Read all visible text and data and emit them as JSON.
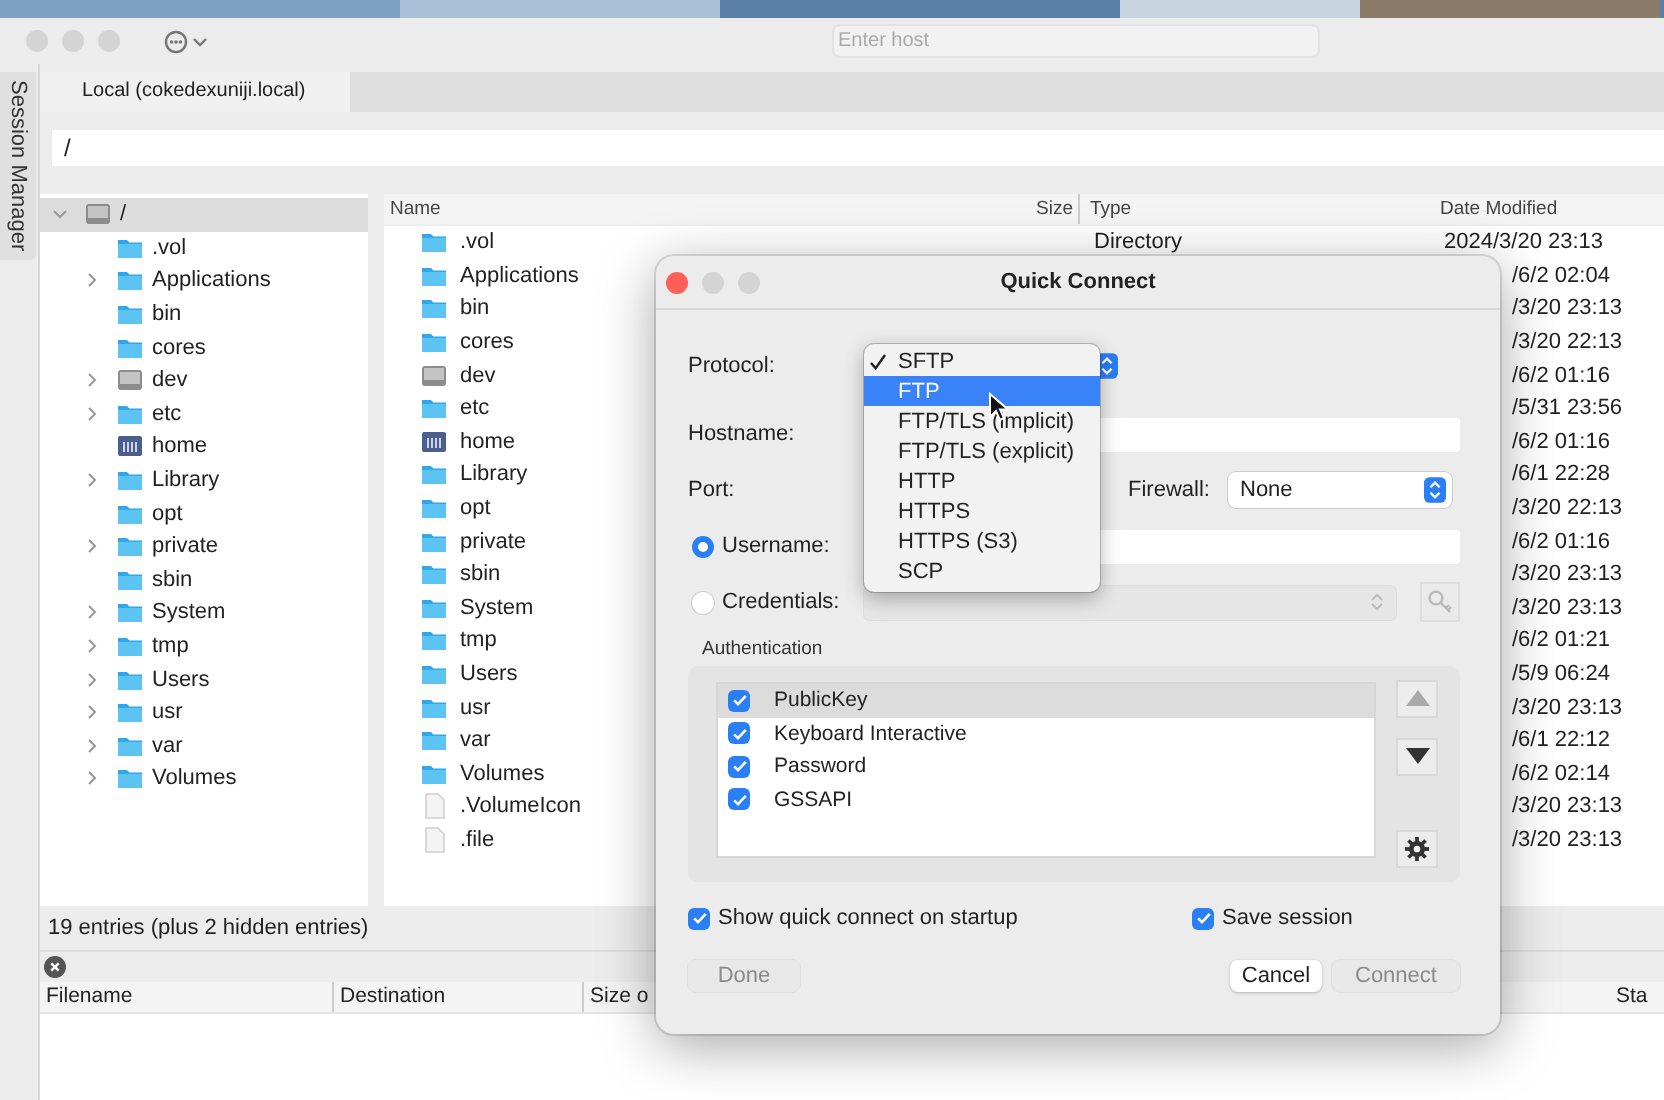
{
  "toolbar": {
    "host_field": {
      "placeholder": "Enter host"
    }
  },
  "session_tab": {
    "label": "Session Manager"
  },
  "tabs": [
    {
      "label": "Local (cokedexuniji.local)",
      "selected": true
    }
  ],
  "path": "/",
  "tree": {
    "label": "/",
    "kind": "drive",
    "expanded": true,
    "selected": true,
    "children": [
      {
        "label": ".vol",
        "kind": "folder",
        "expandable": false
      },
      {
        "label": "Applications",
        "kind": "folder",
        "expandable": true,
        "expanded": false
      },
      {
        "label": "bin",
        "kind": "folder",
        "expandable": false
      },
      {
        "label": "cores",
        "kind": "folder",
        "expandable": false
      },
      {
        "label": "dev",
        "kind": "drive",
        "expandable": true,
        "expanded": false
      },
      {
        "label": "etc",
        "kind": "folder",
        "expandable": true,
        "expanded": false
      },
      {
        "label": "home",
        "kind": "home",
        "expandable": false
      },
      {
        "label": "Library",
        "kind": "folder",
        "expandable": true,
        "expanded": false
      },
      {
        "label": "opt",
        "kind": "folder",
        "expandable": false
      },
      {
        "label": "private",
        "kind": "folder",
        "expandable": true,
        "expanded": false
      },
      {
        "label": "sbin",
        "kind": "folder",
        "expandable": false
      },
      {
        "label": "System",
        "kind": "folder",
        "expandable": true,
        "expanded": false
      },
      {
        "label": "tmp",
        "kind": "folder",
        "expandable": true,
        "expanded": false
      },
      {
        "label": "Users",
        "kind": "folder",
        "expandable": true,
        "expanded": false
      },
      {
        "label": "usr",
        "kind": "folder",
        "expandable": true,
        "expanded": false
      },
      {
        "label": "var",
        "kind": "folder",
        "expandable": true,
        "expanded": false
      },
      {
        "label": "Volumes",
        "kind": "folder",
        "expandable": true,
        "expanded": false
      }
    ]
  },
  "file_list": {
    "columns": [
      "Name",
      "Size",
      "Type",
      "Date Modified"
    ],
    "rows": [
      {
        "name": ".vol",
        "kind": "folder",
        "type": "Directory",
        "date_modified": "2024/3/20 23:13"
      },
      {
        "name": "Applications",
        "kind": "folder",
        "date_modified": "/6/2 02:04"
      },
      {
        "name": "bin",
        "kind": "folder",
        "date_modified": "/3/20 23:13"
      },
      {
        "name": "cores",
        "kind": "folder",
        "date_modified": "/3/20 22:13"
      },
      {
        "name": "dev",
        "kind": "drive",
        "date_modified": "/6/2 01:16"
      },
      {
        "name": "etc",
        "kind": "folder",
        "date_modified": "/5/31 23:56"
      },
      {
        "name": "home",
        "kind": "home",
        "date_modified": "/6/2 01:16"
      },
      {
        "name": "Library",
        "kind": "folder",
        "date_modified": "/6/1 22:28"
      },
      {
        "name": "opt",
        "kind": "folder",
        "date_modified": "/3/20 22:13"
      },
      {
        "name": "private",
        "kind": "folder",
        "date_modified": "/6/2 01:16"
      },
      {
        "name": "sbin",
        "kind": "folder",
        "date_modified": "/3/20 23:13"
      },
      {
        "name": "System",
        "kind": "folder",
        "date_modified": "/3/20 23:13"
      },
      {
        "name": "tmp",
        "kind": "folder",
        "date_modified": "/6/2 01:21"
      },
      {
        "name": "Users",
        "kind": "folder",
        "date_modified": "/5/9 06:24"
      },
      {
        "name": "usr",
        "kind": "folder",
        "date_modified": "/3/20 23:13"
      },
      {
        "name": "var",
        "kind": "folder",
        "date_modified": "/6/1 22:12"
      },
      {
        "name": "Volumes",
        "kind": "folder",
        "date_modified": "/6/2 02:14"
      },
      {
        "name": ".VolumeIcon",
        "kind": "file",
        "date_modified": "/3/20 23:13"
      },
      {
        "name": ".file",
        "kind": "file",
        "date_modified": "/3/20 23:13"
      }
    ]
  },
  "status": "19 entries (plus 2 hidden entries)",
  "transfers": {
    "columns": [
      "Filename",
      "Destination",
      "Size o",
      "Sta"
    ]
  },
  "dialog": {
    "title": "Quick Connect",
    "protocol_label": "Protocol:",
    "protocol_menu": [
      {
        "label": "SFTP",
        "checked": true,
        "selected": false
      },
      {
        "label": "FTP",
        "checked": false,
        "selected": true
      },
      {
        "label": "FTP/TLS (implicit)",
        "checked": false,
        "selected": false
      },
      {
        "label": "FTP/TLS (explicit)",
        "checked": false,
        "selected": false
      },
      {
        "label": "HTTP",
        "checked": false,
        "selected": false
      },
      {
        "label": "HTTPS",
        "checked": false,
        "selected": false
      },
      {
        "label": "HTTPS (S3)",
        "checked": false,
        "selected": false
      },
      {
        "label": "SCP",
        "checked": false,
        "selected": false
      }
    ],
    "hostname_label": "Hostname:",
    "port_label": "Port:",
    "firewall": {
      "label": "Firewall:",
      "value": "None"
    },
    "login": [
      {
        "label": "Username:",
        "kind": "text",
        "selected": true
      },
      {
        "label": "Credentials:",
        "kind": "select",
        "selected": false
      }
    ],
    "authentication": {
      "label": "Authentication",
      "methods": [
        {
          "label": "PublicKey",
          "checked": true,
          "selected": true
        },
        {
          "label": "Keyboard Interactive",
          "checked": true,
          "selected": false
        },
        {
          "label": "Password",
          "checked": true,
          "selected": false
        },
        {
          "label": "GSSAPI",
          "checked": true,
          "selected": false
        }
      ]
    },
    "options": [
      {
        "label": "Show quick connect on startup",
        "checked": true
      },
      {
        "label": "Save session",
        "checked": true
      }
    ],
    "buttons": [
      {
        "label": "Done",
        "disabled": true
      },
      {
        "label": "Cancel",
        "disabled": false
      },
      {
        "label": "Connect",
        "disabled": true
      }
    ]
  }
}
